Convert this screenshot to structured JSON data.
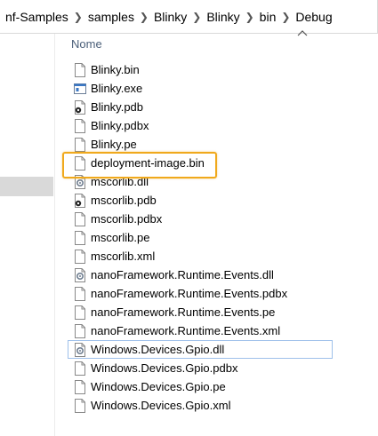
{
  "breadcrumb": [
    "nf-Samples",
    "samples",
    "Blinky",
    "Blinky",
    "bin",
    "Debug"
  ],
  "column_header": "Nome",
  "files": [
    {
      "name": "Blinky.bin",
      "icon": "blank-file-icon"
    },
    {
      "name": "Blinky.exe",
      "icon": "executable-icon"
    },
    {
      "name": "Blinky.pdb",
      "icon": "pdb-file-icon"
    },
    {
      "name": "Blinky.pdbx",
      "icon": "blank-file-icon"
    },
    {
      "name": "Blinky.pe",
      "icon": "blank-file-icon"
    },
    {
      "name": "deployment-image.bin",
      "icon": "blank-file-icon"
    },
    {
      "name": "mscorlib.dll",
      "icon": "dll-gear-icon"
    },
    {
      "name": "mscorlib.pdb",
      "icon": "pdb-file-icon"
    },
    {
      "name": "mscorlib.pdbx",
      "icon": "blank-file-icon"
    },
    {
      "name": "mscorlib.pe",
      "icon": "blank-file-icon"
    },
    {
      "name": "mscorlib.xml",
      "icon": "blank-file-icon"
    },
    {
      "name": "nanoFramework.Runtime.Events.dll",
      "icon": "dll-gear-icon"
    },
    {
      "name": "nanoFramework.Runtime.Events.pdbx",
      "icon": "blank-file-icon"
    },
    {
      "name": "nanoFramework.Runtime.Events.pe",
      "icon": "blank-file-icon"
    },
    {
      "name": "nanoFramework.Runtime.Events.xml",
      "icon": "blank-file-icon"
    },
    {
      "name": "Windows.Devices.Gpio.dll",
      "icon": "dll-gear-icon"
    },
    {
      "name": "Windows.Devices.Gpio.pdbx",
      "icon": "blank-file-icon"
    },
    {
      "name": "Windows.Devices.Gpio.pe",
      "icon": "blank-file-icon"
    },
    {
      "name": "Windows.Devices.Gpio.xml",
      "icon": "blank-file-icon"
    }
  ],
  "highlighted_file": "deployment-image.bin",
  "focused_file": "Windows.Devices.Gpio.dll",
  "colors": {
    "highlight": "#f0a91c",
    "focus_border": "#9ec0ea",
    "header_text": "#4c607a",
    "nav_selected": "#d9d9d9"
  }
}
